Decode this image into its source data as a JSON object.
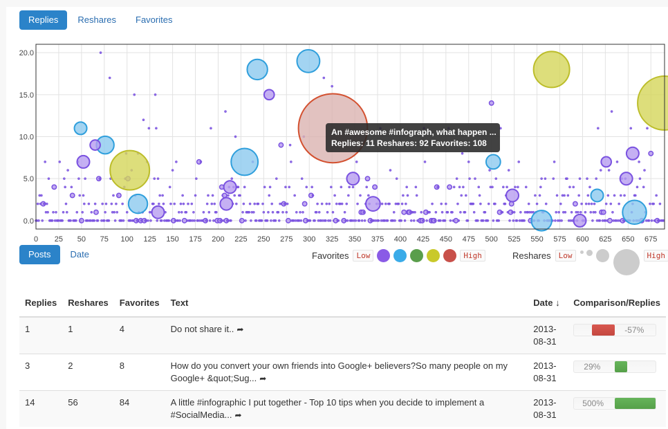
{
  "top_tabs": [
    {
      "label": "Replies",
      "active": true
    },
    {
      "label": "Reshares",
      "active": false
    },
    {
      "label": "Favorites",
      "active": false
    }
  ],
  "bottom_tabs": [
    {
      "label": "Posts",
      "active": true
    },
    {
      "label": "Date",
      "active": false
    }
  ],
  "tooltip": {
    "line1": "An #awesome #infograph, what happen ...",
    "line2": "Replies: 11 Reshares: 92 Favorites: 108"
  },
  "legend": {
    "favorites_label": "Favorites",
    "reshares_label": "Reshares",
    "low": "Low",
    "high": "High",
    "favorite_colors": [
      "#8a5be6",
      "#3aabe8",
      "#5a9e4b",
      "#c9c92a",
      "#c8504a"
    ]
  },
  "table": {
    "headers": [
      "Replies",
      "Reshares",
      "Favorites",
      "Text",
      "Date ↓",
      "Comparison/Replies"
    ],
    "rows": [
      {
        "replies": "1",
        "reshares": "1",
        "favorites": "4",
        "text": "Do not share it..",
        "date": "2013-08-31",
        "comparison": "-57%",
        "comparison_value": -57
      },
      {
        "replies": "3",
        "reshares": "2",
        "favorites": "8",
        "text": "How do you convert your own friends into Google+ believers?So many people on my Google+ &quot;Sug...",
        "date": "2013-08-31",
        "comparison": "29%",
        "comparison_value": 29
      },
      {
        "replies": "14",
        "reshares": "56",
        "favorites": "84",
        "text": "A little #infographic I put together - Top 10 tips when you decide to implement a #SocialMedia...",
        "date": "2013-08-31",
        "comparison": "500%",
        "comparison_value": 500
      }
    ]
  },
  "chart_data": {
    "type": "scatter",
    "title": "",
    "xlabel": "Posts",
    "ylabel": "Replies",
    "xlim": [
      0,
      690
    ],
    "ylim": [
      -1,
      21
    ],
    "x_ticks": [
      0,
      25,
      50,
      75,
      100,
      125,
      150,
      175,
      200,
      225,
      250,
      275,
      300,
      325,
      350,
      375,
      400,
      425,
      450,
      475,
      500,
      525,
      550,
      575,
      600,
      625,
      650,
      675
    ],
    "y_ticks": [
      "0.0",
      "5.0",
      "10.0",
      "15.0",
      "20.0"
    ],
    "grid": true,
    "size_encodes": "Reshares",
    "color_encodes": "Favorites",
    "highlighted_bubbles": [
      {
        "x": 49,
        "y": 11,
        "size": 3,
        "color": "blue"
      },
      {
        "x": 76,
        "y": 9,
        "size": 6,
        "color": "blue"
      },
      {
        "x": 103,
        "y": 6,
        "size": 30,
        "color": "yellow"
      },
      {
        "x": 112,
        "y": 2,
        "size": 7,
        "color": "blue"
      },
      {
        "x": 229,
        "y": 7,
        "size": 14,
        "color": "blue"
      },
      {
        "x": 243,
        "y": 18,
        "size": 8,
        "color": "blue"
      },
      {
        "x": 299,
        "y": 19,
        "size": 10,
        "color": "blue"
      },
      {
        "x": 326,
        "y": 11,
        "size": 92,
        "color": "red"
      },
      {
        "x": 502,
        "y": 7,
        "size": 4,
        "color": "blue"
      },
      {
        "x": 555,
        "y": 0,
        "size": 8,
        "color": "blue"
      },
      {
        "x": 566,
        "y": 18,
        "size": 25,
        "color": "yellow"
      },
      {
        "x": 616,
        "y": 3,
        "size": 3,
        "color": "blue"
      },
      {
        "x": 657,
        "y": 1,
        "size": 11,
        "color": "blue"
      },
      {
        "x": 690,
        "y": 14,
        "size": 56,
        "color": "yellow"
      },
      {
        "x": 65,
        "y": 9,
        "size": 2,
        "color": "purple"
      },
      {
        "x": 52,
        "y": 7,
        "size": 3,
        "color": "purple"
      },
      {
        "x": 256,
        "y": 15,
        "size": 2,
        "color": "purple"
      },
      {
        "x": 209,
        "y": 2,
        "size": 3,
        "color": "purple"
      },
      {
        "x": 213,
        "y": 4,
        "size": 3,
        "color": "purple"
      },
      {
        "x": 655,
        "y": 8,
        "size": 3,
        "color": "purple"
      },
      {
        "x": 626,
        "y": 7,
        "size": 2,
        "color": "purple"
      },
      {
        "x": 648,
        "y": 5,
        "size": 3,
        "color": "purple"
      },
      {
        "x": 523,
        "y": 3,
        "size": 3,
        "color": "purple"
      },
      {
        "x": 348,
        "y": 5,
        "size": 3,
        "color": "purple"
      },
      {
        "x": 370,
        "y": 2,
        "size": 4,
        "color": "purple"
      },
      {
        "x": 134,
        "y": 1,
        "size": 3,
        "color": "purple"
      },
      {
        "x": 597,
        "y": 0,
        "size": 3,
        "color": "purple"
      }
    ],
    "note": "Hundreds of small purple points concentrated at Replies 0-4 across all posts; scattered points up to 20."
  }
}
